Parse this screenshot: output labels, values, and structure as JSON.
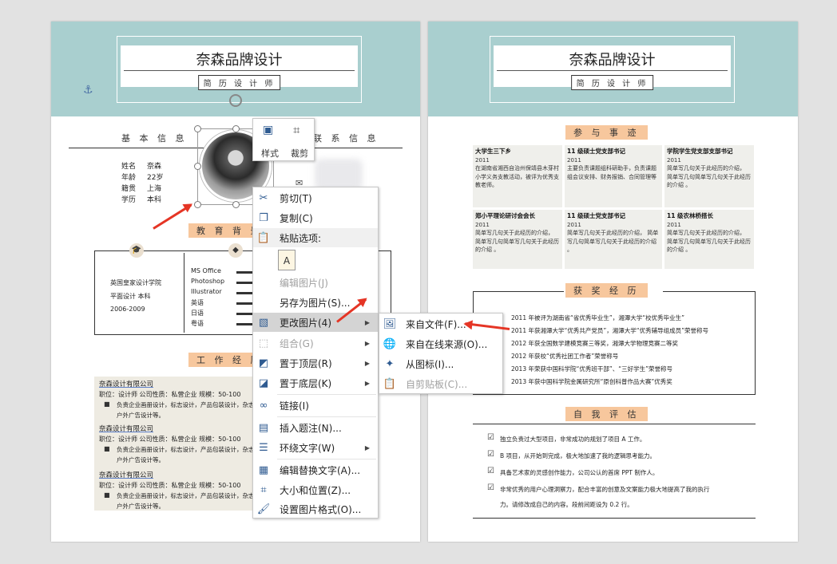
{
  "left_page": {
    "title": "奈森品牌设计",
    "subtitle": "简 历 设 计 师",
    "basic_info_heading": "基 本 信 息",
    "contact_heading": "联 系 信 息",
    "info_labels": [
      "姓名",
      "年龄",
      "籍贯",
      "学历"
    ],
    "info_values": [
      "奈森",
      "22岁",
      "上海",
      "本科"
    ],
    "edu_heading": "教 育 背 景",
    "edu_lines": [
      "英国皇家设计学院",
      "平面设计  本科",
      "2006-2009"
    ],
    "skills": [
      "MS Office",
      "Photoshop",
      "Illustrator",
      "英语",
      "日语",
      "粤语"
    ],
    "work_heading": "工 作 经 历",
    "jobs": [
      {
        "company": "奈森设计有限公司",
        "meta": "职位：设计师   公司性质：私营企业   规模：50-100",
        "desc1": "负责企业画册设计，标志设计，产品包装设计，杂志",
        "desc2": "户外广告设计等。"
      },
      {
        "company": "奈森设计有限公司",
        "meta": "职位：设计师   公司性质：私营企业   规模：50-100",
        "desc1": "负责企业画册设计，标志设计，产品包装设计，杂志",
        "desc2": "户外广告设计等。"
      },
      {
        "company": "奈森设计有限公司",
        "meta": "职位：设计师   公司性质：私营企业   规模：50-100",
        "desc1": "负责企业画册设计，标志设计，产品包装设计，杂志",
        "desc2": "户外广告设计等。"
      }
    ]
  },
  "right_page": {
    "title": "奈森品牌设计",
    "subtitle": "简 历 设 计 师",
    "activities_heading": "参 与 事 迹",
    "activities": [
      {
        "title": "大学生三下乡",
        "year": "2011",
        "text": "在湖南省湘西自治州保靖县木芽村小学义务支教活动，被评为优秀支教老师。"
      },
      {
        "title": "11 级硕士党支部书记",
        "year": "2011",
        "text": "主要负责课题组科研助手，负责课题组会议安排、财务报销、合同管理等"
      },
      {
        "title": "学院学生党支部支部书记",
        "year": "2011",
        "text": "简单写几句关于此经历的介绍， 简单写几句简单写几句关于此经历的介绍 。"
      },
      {
        "title": "郑小平理论研讨会会长",
        "year": "2011",
        "text": "简单写几句关于此经历的介绍， 简单写几句简单写几句关于此经历的介绍 。"
      },
      {
        "title": "11 级硕士党支部书记",
        "year": "2011",
        "text": "简单写几句关于此经历的介绍， 简单写几句简单写几句关于此经历的介绍 。"
      },
      {
        "title": "11 级农林桥搭长",
        "year": "2011",
        "text": "简单写几句关于此经历的介绍， 简单写几句简单写几句关于此经历的介绍 。"
      }
    ],
    "awards_heading": "获 奖 经 历",
    "awards": [
      "2011 年被评为湖南省“省优秀毕业生”，湘潭大学“校优秀毕业生”",
      "2011 年获湘潭大学“优秀共产党员”，湘潭大学“优秀辅导组成员”荣誉称号",
      "2012 年获全国数学建模竞赛三等奖，湘潭大学物理竞赛二等奖",
      "2012 年获校“优秀社团工作者”荣誉称号",
      "2013 年荣获中国科学院“优秀班干部”、“三好学生”荣誉称号",
      "2013 年获中国科学院金属研究所“原创科普作品大赛”优秀奖"
    ],
    "self_heading": "自 我 评 估",
    "self_eval": [
      "独立负责过大型项目，非常成功的规划了项目 A 工作。",
      "B 项目，从开始到完成，极大地加速了我的逻辑思考能力。",
      "具备艺术家的灵感创作能力，公司公认的首席 PPT 制作人。",
      "非常优秀的用户心理洞察力，配合丰富的创意及文案能力极大地提高了我的执行",
      "力。请修改成自己的内容。段前间距设为 0.2 行。"
    ]
  },
  "toolbar": {
    "style_label": "样式",
    "crop_label": "裁剪"
  },
  "context_menu": {
    "items": [
      {
        "label": "剪切(T)",
        "icon": "scissors-icon",
        "disabled": false
      },
      {
        "label": "复制(C)",
        "icon": "copy-icon",
        "disabled": false
      },
      {
        "label": "粘贴选项:",
        "icon": "paste-icon",
        "disabled": false
      },
      {
        "label": "编辑图片(J)",
        "icon": "",
        "disabled": true
      },
      {
        "label": "另存为图片(S)...",
        "icon": "",
        "disabled": false
      },
      {
        "label": "更改图片(4)",
        "icon": "change-picture-icon",
        "disabled": false
      },
      {
        "label": "组合(G)",
        "icon": "group-icon",
        "disabled": true
      },
      {
        "label": "置于顶层(R)",
        "icon": "bring-front-icon",
        "disabled": false
      },
      {
        "label": "置于底层(K)",
        "icon": "send-back-icon",
        "disabled": false
      },
      {
        "label": "链接(I)",
        "icon": "link-icon",
        "disabled": false
      },
      {
        "label": "插入题注(N)...",
        "icon": "caption-icon",
        "disabled": false
      },
      {
        "label": "环绕文字(W)",
        "icon": "wrap-text-icon",
        "disabled": false
      },
      {
        "label": "编辑替换文字(A)...",
        "icon": "alt-text-icon",
        "disabled": false
      },
      {
        "label": "大小和位置(Z)...",
        "icon": "size-position-icon",
        "disabled": false
      },
      {
        "label": "设置图片格式(O)...",
        "icon": "format-picture-icon",
        "disabled": false
      }
    ],
    "paste_option_letter": "A"
  },
  "submenu": {
    "items": [
      {
        "label": "来自文件(F)...",
        "disabled": false
      },
      {
        "label": "来自在线来源(O)...",
        "disabled": false
      },
      {
        "label": "从图标(I)...",
        "disabled": false
      },
      {
        "label": "自剪贴板(C)...",
        "disabled": true
      }
    ]
  },
  "colors": {
    "header_band": "#a9cfcf",
    "section_tag": "#f7c79d",
    "arrow": "#e53525",
    "menu_hover": "#d4d4d4"
  }
}
